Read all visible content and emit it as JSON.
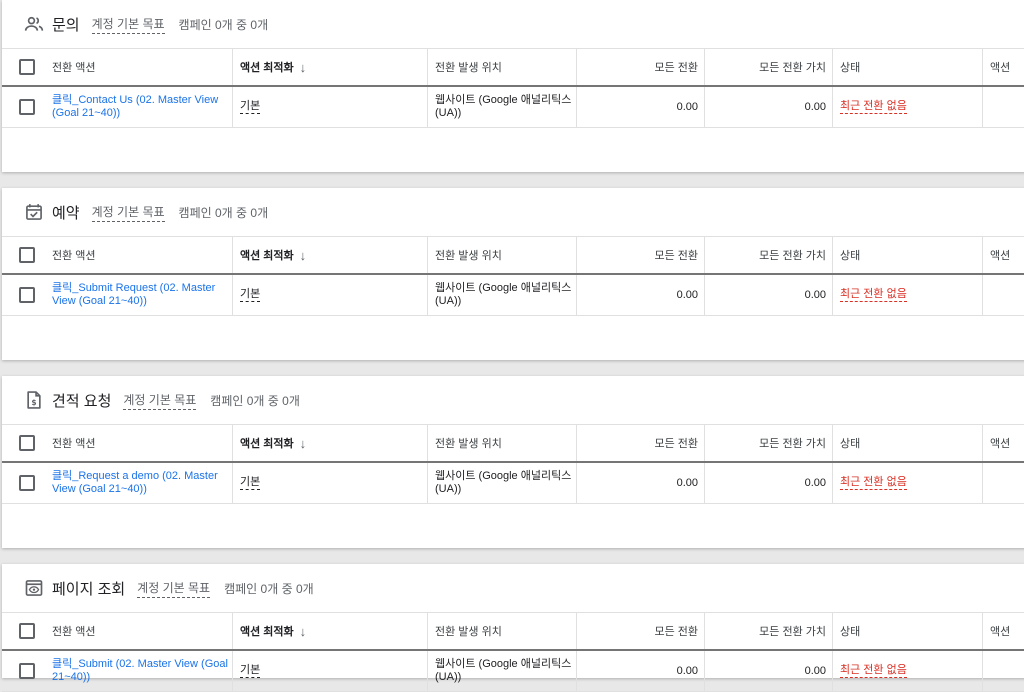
{
  "colors": {
    "link": "#1a73e8",
    "status": "#d93025",
    "text": "#202124",
    "muted": "#5f6368"
  },
  "columns": {
    "action": "전환 액션",
    "optimization": "액션 최적화",
    "source": "전환 발생 위치",
    "all_conversions": "모든 전환",
    "all_value": "모든 전환 가치",
    "status": "상태",
    "actions": "액션"
  },
  "sections": [
    {
      "title": "문의",
      "icon": "people-icon",
      "goal": "계정 기본 목표",
      "campaigns": "캠페인 0개 중 0개",
      "rows": [
        {
          "action": "클릭_Contact Us (02. Master View (Goal 21~40))",
          "optimization": "기본",
          "source": "웹사이트 (Google 애널리틱스 (UA))",
          "all_conversions": "0.00",
          "all_value": "0.00",
          "status": "최근 전환 없음"
        }
      ]
    },
    {
      "title": "예약",
      "icon": "calendar-check-icon",
      "goal": "계정 기본 목표",
      "campaigns": "캠페인 0개 중 0개",
      "rows": [
        {
          "action": "클릭_Submit Request (02. Master View (Goal 21~40))",
          "optimization": "기본",
          "source": "웹사이트 (Google 애널리틱스 (UA))",
          "all_conversions": "0.00",
          "all_value": "0.00",
          "status": "최근 전환 없음"
        }
      ]
    },
    {
      "title": "견적 요청",
      "icon": "quote-document-icon",
      "goal": "계정 기본 목표",
      "campaigns": "캠페인 0개 중 0개",
      "rows": [
        {
          "action": "클릭_Request a demo (02. Master View (Goal 21~40))",
          "optimization": "기본",
          "source": "웹사이트 (Google 애널리틱스 (UA))",
          "all_conversions": "0.00",
          "all_value": "0.00",
          "status": "최근 전환 없음"
        }
      ]
    },
    {
      "title": "페이지 조회",
      "icon": "page-view-icon",
      "goal": "계정 기본 목표",
      "campaigns": "캠페인 0개 중 0개",
      "rows": [
        {
          "action": "클릭_Submit (02. Master View (Goal 21~40))",
          "optimization": "기본",
          "source": "웹사이트 (Google 애널리틱스 (UA))",
          "all_conversions": "0.00",
          "all_value": "0.00",
          "status": "최근 전환 없음"
        }
      ]
    }
  ]
}
